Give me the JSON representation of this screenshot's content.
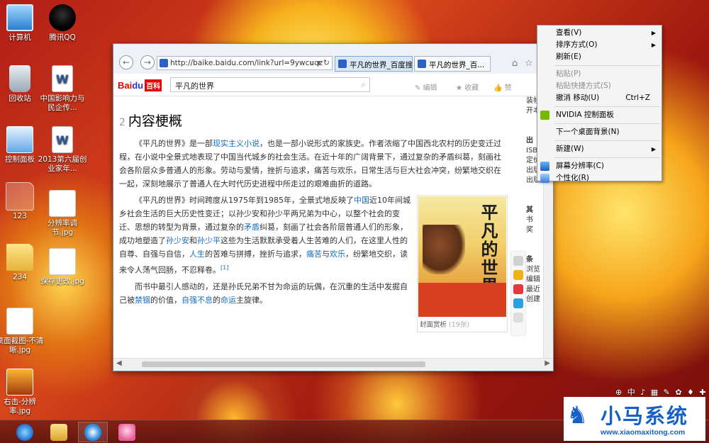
{
  "desktop": {
    "icons": [
      {
        "label": "计算机",
        "icon": "computer-icon"
      },
      {
        "label": "腾讯QQ",
        "icon": "qq-icon"
      },
      {
        "label": "回收站",
        "icon": "recycle-bin-icon"
      },
      {
        "label": "中国影响力与民企传...",
        "icon": "word-document-icon"
      },
      {
        "label": "控制面板",
        "icon": "control-panel-icon"
      },
      {
        "label": "2013第六届创业家年...",
        "icon": "word-document-icon"
      },
      {
        "label": "123",
        "icon": "folder-icon"
      },
      {
        "label": "分辨率调节.jpg",
        "icon": "image-file-icon"
      },
      {
        "label": "234",
        "icon": "folder-icon"
      },
      {
        "label": "保存更改.jpg",
        "icon": "image-file-icon"
      },
      {
        "label": "桌面截图-不清晰.jpg",
        "icon": "image-file-icon"
      },
      {
        "label": "右击-分辨率.jpg",
        "icon": "image-file-icon"
      }
    ]
  },
  "browser": {
    "url": "http://baike.baidu.com/link?url=9ywcuqz",
    "url_tools": "⌕ ▾ ↻",
    "tabs": [
      {
        "label": "平凡的世界_百度搜索",
        "active": true
      },
      {
        "label": "平凡的世界_百...",
        "active": false
      }
    ],
    "tab_close": "×",
    "toolbar_icons": [
      "⌂",
      "☆",
      "⚙"
    ]
  },
  "baike": {
    "logo_bai": "Bai",
    "logo_paw": "du",
    "logo_baike": "百科",
    "search_value": "平凡的世界",
    "actions": [
      {
        "label": "✎ 编辑",
        "icon": "edit-icon"
      },
      {
        "label": "★ 收藏",
        "icon": "star-icon"
      },
      {
        "label": "👍 赞",
        "icon": "like-icon"
      }
    ],
    "section_num": "2",
    "section_title": "内容梗概",
    "p1": {
      "a": "《平凡的世界》是一部",
      "link1": "现实主义",
      "link2": "小说",
      "b": "，也是一部小说形式的家族史。作者浓缩了中国西北农村的历史变迁过程，在小说中全景式地表现了中国当代城乡的社会生活。在近十年的广阔背景下，通过复杂的矛盾纠葛，刻画社会各阶层众多普通人的形象。劳动与爱情，挫折与追求，痛苦与欢乐，日常生活与巨大社会冲突，纷繁地交织在一起，深刻地展示了普通人在大时代历史进程中所走过的艰难曲折的道路。"
    },
    "p2": {
      "a": "《平凡的世界》时间跨度从1975年到1985年，全景式地反映了",
      "link1": "中国",
      "b": "近10年间城乡社会生活的巨大历史性变迁；以孙少安和孙少平两兄弟为中心，以整个社会的变迁、思想的转型为背景，通过复杂的",
      "link2": "矛盾",
      "c": "纠葛，刻画了社会各阶层普通人们的形象，成功地塑造了",
      "link3": "孙少安",
      "d": "和",
      "link4": "孙少平",
      "e": "这些为生活默默承受着人生苦难的人们，在这里人性的自尊、自强与自信，",
      "link5": "人生",
      "f": "的苦难与拼搏，挫折与追求，",
      "link6": "痛苦",
      "g": "与",
      "link7": "欢乐",
      "h": "，纷繁地交织，读来令人荡气回肠，不忍释卷。",
      "ref": "[1]"
    },
    "p3": {
      "a": "而书中最引人感动的，还是孙氏兄弟不甘为命运的玩偶，在沉重的生活中发掘自己被",
      "link1": "禁锢",
      "b": "的价值，",
      "link2": "自强不息",
      "c": "的",
      "link3": "命运",
      "d": "主旋律。"
    },
    "cover_title": "平凡的世界",
    "cover_caption": "封面赏析",
    "cover_count": "(19张)",
    "sidebar_lines": [
      "装帧",
      "开本",
      "",
      "",
      "出",
      "ISB",
      "定价",
      "出版",
      "出版",
      "",
      "",
      "其",
      "书",
      "奖",
      "",
      "",
      "条",
      "浏览",
      "编辑",
      "最近",
      "创建"
    ]
  },
  "context_menu": {
    "items": [
      {
        "label": "查看(V)",
        "submenu": true,
        "disabled": false
      },
      {
        "label": "排序方式(O)",
        "submenu": true,
        "disabled": false
      },
      {
        "label": "刷新(E)",
        "submenu": false,
        "disabled": false
      },
      {
        "sep": true
      },
      {
        "label": "粘贴(P)",
        "submenu": false,
        "disabled": true
      },
      {
        "label": "粘贴快捷方式(S)",
        "submenu": false,
        "disabled": true
      },
      {
        "label": "撤消 移动(U)",
        "shortcut": "Ctrl+Z",
        "submenu": false,
        "disabled": false
      },
      {
        "sep": true
      },
      {
        "label": "NVIDIA 控制面板",
        "icon": "nvidia-icon",
        "submenu": false,
        "disabled": false
      },
      {
        "sep": true
      },
      {
        "label": "下一个桌面背景(N)",
        "submenu": false,
        "disabled": false
      },
      {
        "sep": true
      },
      {
        "label": "新建(W)",
        "submenu": true,
        "disabled": false
      },
      {
        "sep": true
      },
      {
        "label": "屏幕分辨率(C)",
        "icon": "display-icon",
        "submenu": false,
        "disabled": false
      },
      {
        "label": "个性化(R)",
        "icon": "personalize-icon",
        "submenu": false,
        "disabled": false
      }
    ]
  },
  "taskbar": {
    "buttons": [
      "internet-explorer-icon",
      "file-explorer-icon",
      "sogou-browser-icon",
      "anime-avatar-app-icon"
    ],
    "tray": "⊕ 中 ♪ ▦ ✎ ✿ ♦ ✚"
  },
  "watermark": {
    "name": "小马系统",
    "url": "www.xiaomaxitong.com"
  },
  "colors": {
    "baidu_red": "#e10601",
    "baidu_blue": "#2932e1",
    "link_blue": "#136ec2",
    "watermark_blue": "#1761c6"
  }
}
